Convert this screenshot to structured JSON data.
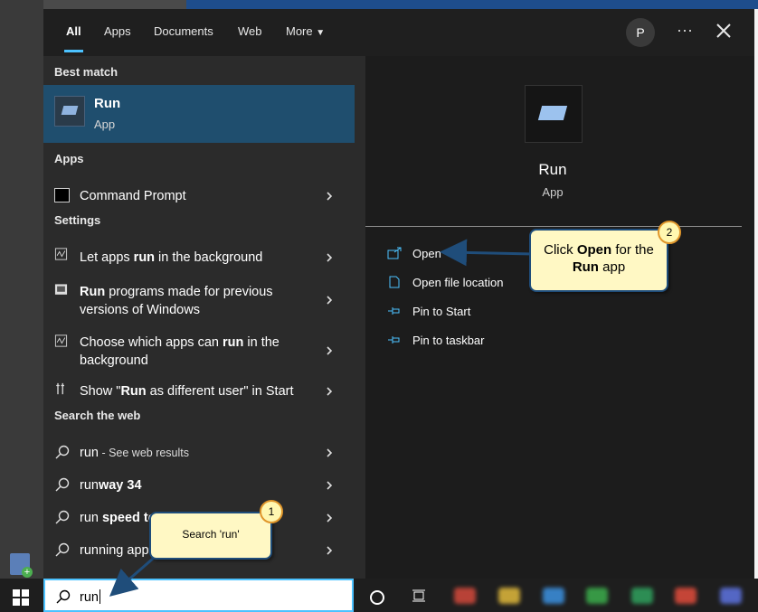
{
  "tabs": {
    "all": "All",
    "apps": "Apps",
    "documents": "Documents",
    "web": "Web",
    "more": "More"
  },
  "user": {
    "avatar_initial": "P"
  },
  "left": {
    "best_match_header": "Best match",
    "best_match": {
      "name": "Run",
      "type": "App"
    },
    "apps_header": "Apps",
    "apps": [
      {
        "label": "Command Prompt"
      }
    ],
    "settings_header": "Settings",
    "settings": [
      {
        "pre": "Let apps ",
        "bold": "run",
        "post": " in the background"
      },
      {
        "pre": "",
        "bold": "Run",
        "post": " programs made for previous versions of Windows"
      },
      {
        "pre": "Choose which apps can ",
        "bold": "run",
        "post": " in the background"
      },
      {
        "pre": "Show \"",
        "bold": "Run",
        "post": " as different user\" in Start"
      }
    ],
    "web_header": "Search the web",
    "web": [
      {
        "pre": "run",
        "bold": "",
        "post": " - See web results"
      },
      {
        "pre": "run",
        "bold": "way 34",
        "post": ""
      },
      {
        "pre": "run",
        "bold": " speed te",
        "post": ""
      },
      {
        "pre": "running app",
        "bold": "",
        "post": ""
      }
    ]
  },
  "right": {
    "app_name": "Run",
    "app_type": "App",
    "actions": [
      "Open",
      "Open file location",
      "Pin to Start",
      "Pin to taskbar"
    ]
  },
  "callouts": {
    "c1": {
      "number": "1",
      "text": "Search 'run'"
    },
    "c2": {
      "number": "2",
      "pre": "Click ",
      "bold1": "Open",
      "mid": " for the ",
      "bold2": "Run",
      "post": " app"
    }
  },
  "search": {
    "value": "run"
  },
  "colors": {
    "accent": "#4cc2ff",
    "best_match_bg": "#1f4e6e",
    "callout_bg": "#fff8c4",
    "callout_border": "#1f4d7a"
  }
}
